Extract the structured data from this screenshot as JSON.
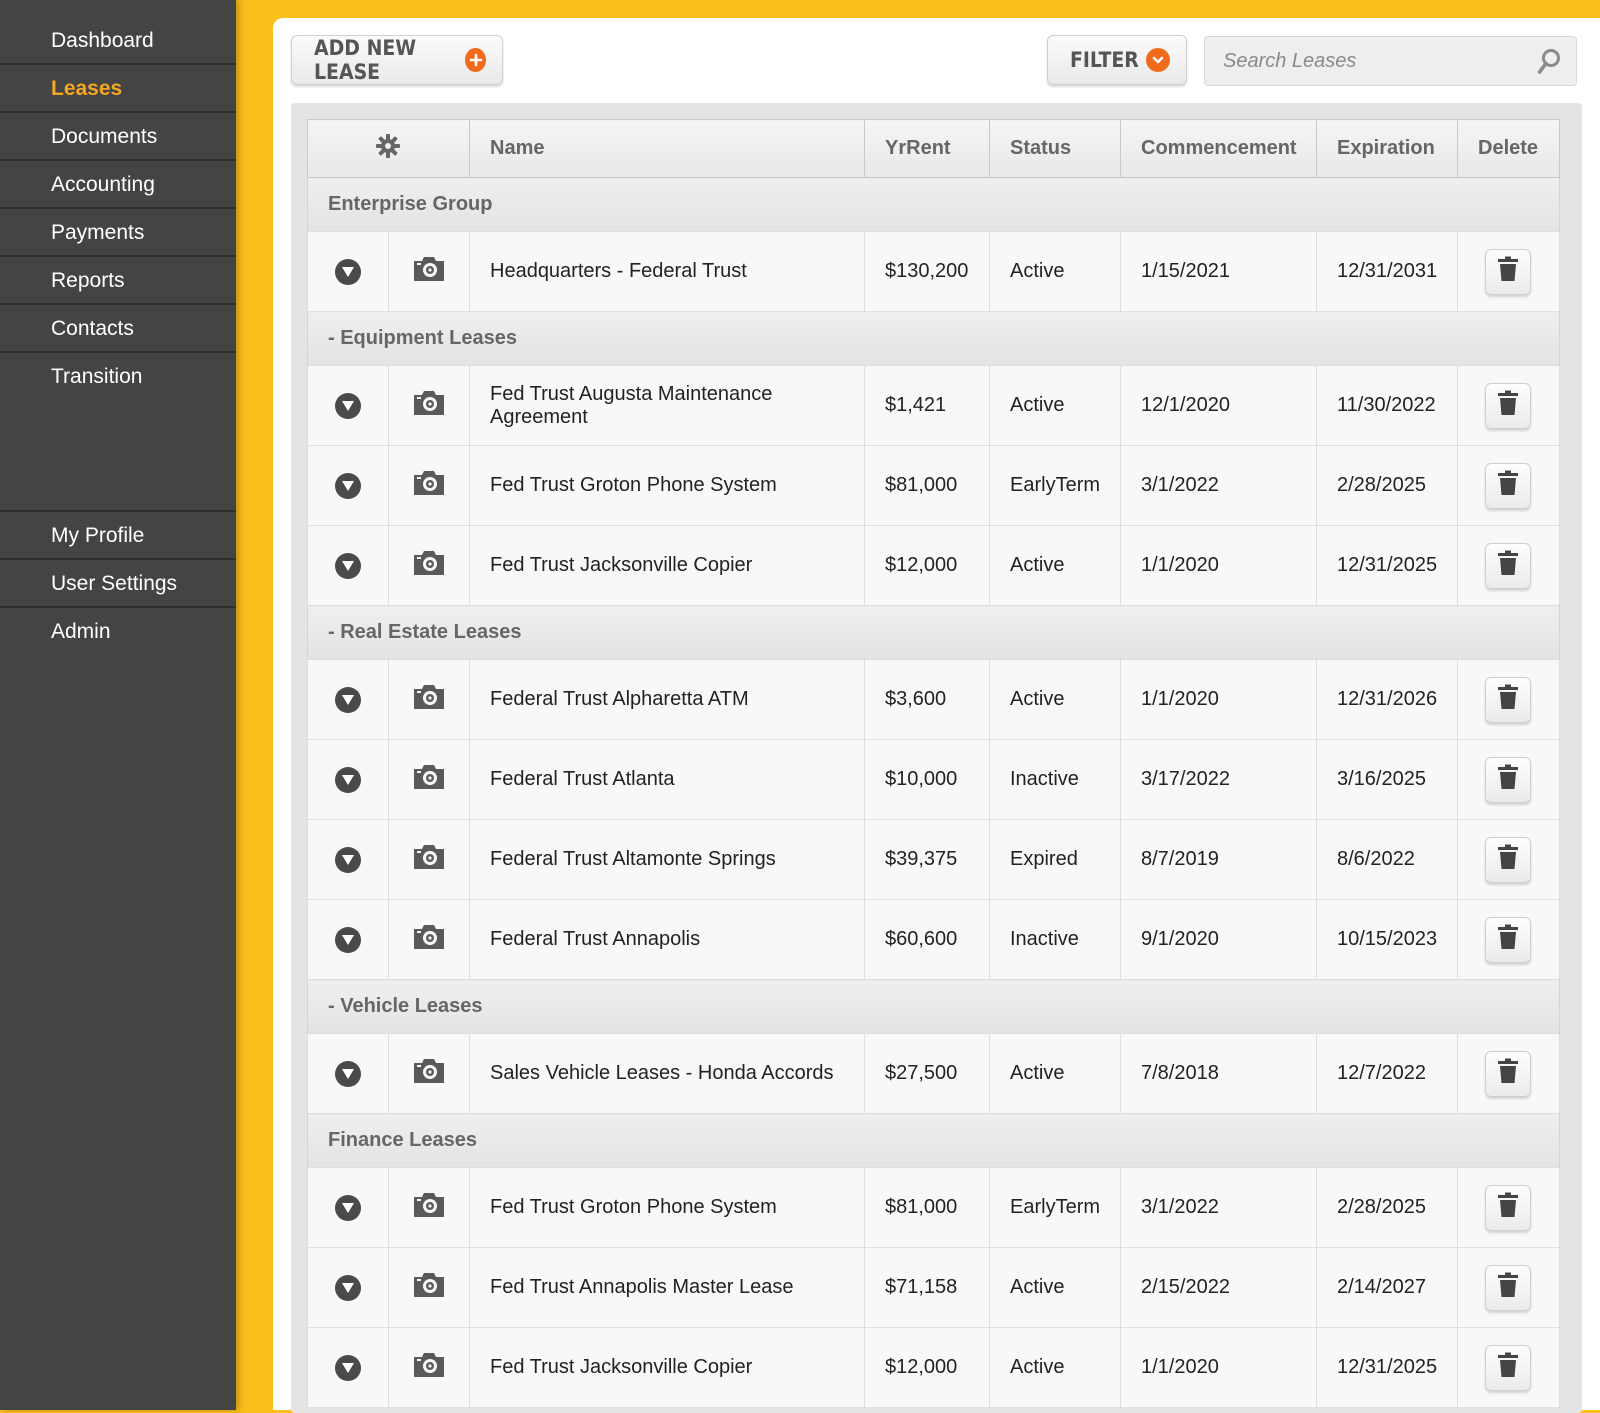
{
  "sidebar": {
    "top_items": [
      {
        "label": "Dashboard",
        "active": false
      },
      {
        "label": "Leases",
        "active": true
      },
      {
        "label": "Documents",
        "active": false
      },
      {
        "label": "Accounting",
        "active": false
      },
      {
        "label": "Payments",
        "active": false
      },
      {
        "label": "Reports",
        "active": false
      },
      {
        "label": "Contacts",
        "active": false
      },
      {
        "label": "Transition",
        "active": false
      }
    ],
    "bottom_items": [
      {
        "label": "My Profile"
      },
      {
        "label": "User Settings"
      },
      {
        "label": "Admin"
      }
    ]
  },
  "toolbar": {
    "add_label": "ADD NEW LEASE",
    "add_icon": "plus-circle-icon",
    "filter_label": "FILTER",
    "filter_icon": "chevron-down-circle-icon",
    "search_placeholder": "Search Leases",
    "accent_color": "#f26a1b"
  },
  "table": {
    "headers": {
      "settings_icon": "gear-icon",
      "name": "Name",
      "yr_rent": "YrRent",
      "status": "Status",
      "commencement": "Commencement",
      "expiration": "Expiration",
      "delete": "Delete"
    },
    "groups": [
      {
        "title": "Enterprise Group",
        "rows": [
          {
            "name": "Headquarters - Federal Trust",
            "rent": "$130,200",
            "status": "Active",
            "start": "1/15/2021",
            "end": "12/31/2031"
          }
        ]
      },
      {
        "title": "- Equipment Leases",
        "rows": [
          {
            "name": "Fed Trust Augusta Maintenance Agreement",
            "rent": "$1,421",
            "status": "Active",
            "start": "12/1/2020",
            "end": "11/30/2022"
          },
          {
            "name": "Fed Trust Groton Phone System",
            "rent": "$81,000",
            "status": "EarlyTerm",
            "start": "3/1/2022",
            "end": "2/28/2025"
          },
          {
            "name": "Fed Trust Jacksonville Copier",
            "rent": "$12,000",
            "status": "Active",
            "start": "1/1/2020",
            "end": "12/31/2025"
          }
        ]
      },
      {
        "title": "- Real Estate Leases",
        "rows": [
          {
            "name": "Federal Trust Alpharetta ATM",
            "rent": "$3,600",
            "status": "Active",
            "start": "1/1/2020",
            "end": "12/31/2026"
          },
          {
            "name": "Federal Trust Atlanta",
            "rent": "$10,000",
            "status": "Inactive",
            "start": "3/17/2022",
            "end": "3/16/2025"
          },
          {
            "name": "Federal Trust Altamonte Springs",
            "rent": "$39,375",
            "status": "Expired",
            "start": "8/7/2019",
            "end": "8/6/2022"
          },
          {
            "name": "Federal Trust Annapolis",
            "rent": "$60,600",
            "status": "Inactive",
            "start": "9/1/2020",
            "end": "10/15/2023"
          }
        ]
      },
      {
        "title": "- Vehicle Leases",
        "rows": [
          {
            "name": "Sales Vehicle Leases - Honda Accords",
            "rent": "$27,500",
            "status": "Active",
            "start": "7/8/2018",
            "end": "12/7/2022"
          }
        ]
      },
      {
        "title": "Finance Leases",
        "rows": [
          {
            "name": "Fed Trust Groton Phone System",
            "rent": "$81,000",
            "status": "EarlyTerm",
            "start": "3/1/2022",
            "end": "2/28/2025"
          },
          {
            "name": "Fed Trust Annapolis Master Lease",
            "rent": "$71,158",
            "status": "Active",
            "start": "2/15/2022",
            "end": "2/14/2027"
          },
          {
            "name": "Fed Trust Jacksonville Copier",
            "rent": "$12,000",
            "status": "Active",
            "start": "1/1/2020",
            "end": "12/31/2025"
          }
        ]
      }
    ]
  }
}
